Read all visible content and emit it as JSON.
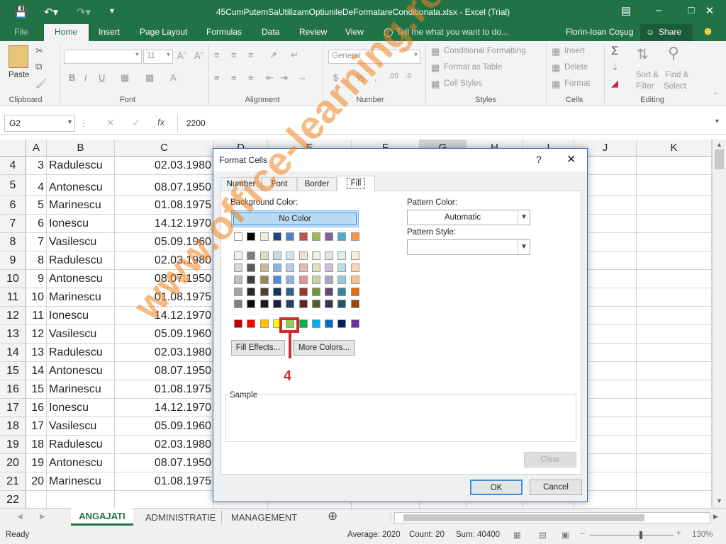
{
  "window": {
    "title": "45CumPutemSaUtilizamOptiunileDeFormatareConditionata.xlsx - Excel (Trial)"
  },
  "ribbon_tabs": [
    {
      "label": "File"
    },
    {
      "label": "Home"
    },
    {
      "label": "Insert"
    },
    {
      "label": "Page Layout"
    },
    {
      "label": "Formulas"
    },
    {
      "label": "Data"
    },
    {
      "label": "Review"
    },
    {
      "label": "View"
    }
  ],
  "tell_me": "Tell me what you want to do...",
  "user": "Florin-Ioan Coşug",
  "share": "Share",
  "ribbon": {
    "paste": "Paste",
    "clipboard": "Clipboard",
    "font_group": "Font",
    "font_size": "11",
    "alignment": "Alignment",
    "number_format": "General",
    "number_group": "Number",
    "conditional_formatting": "Conditional Formatting",
    "format_as_table": "Format as Table",
    "cell_styles": "Cell Styles",
    "styles_group": "Styles",
    "insert": "Insert",
    "delete": "Delete",
    "format": "Format",
    "cells_group": "Cells",
    "sort_filter_1": "Sort &",
    "sort_filter_2": "Filter",
    "find_select_1": "Find &",
    "find_select_2": "Select",
    "editing_group": "Editing"
  },
  "formula_bar": {
    "name_box": "G2",
    "fx": "fx",
    "value": "2200"
  },
  "columns": [
    "A",
    "B",
    "C",
    "D",
    "E",
    "F",
    "G",
    "H",
    "I",
    "J",
    "K"
  ],
  "rows": [
    {
      "n": "4",
      "a": "3",
      "b": "Radulescu",
      "c": "02.03.1980"
    },
    {
      "n": "5",
      "a": "4",
      "b": "Antonescu",
      "c": "08.07.1950"
    },
    {
      "n": "6",
      "a": "5",
      "b": "Marinescu",
      "c": "01.08.1975"
    },
    {
      "n": "7",
      "a": "6",
      "b": "Ionescu",
      "c": "14.12.1970"
    },
    {
      "n": "8",
      "a": "7",
      "b": "Vasilescu",
      "c": "05.09.1960"
    },
    {
      "n": "9",
      "a": "8",
      "b": "Radulescu",
      "c": "02.03.1980"
    },
    {
      "n": "10",
      "a": "9",
      "b": "Antonescu",
      "c": "08.07.1950"
    },
    {
      "n": "11",
      "a": "10",
      "b": "Marinescu",
      "c": "01.08.1975"
    },
    {
      "n": "12",
      "a": "11",
      "b": "Ionescu",
      "c": "14.12.1970"
    },
    {
      "n": "13",
      "a": "12",
      "b": "Vasilescu",
      "c": "05.09.1960"
    },
    {
      "n": "14",
      "a": "13",
      "b": "Radulescu",
      "c": "02.03.1980"
    },
    {
      "n": "15",
      "a": "14",
      "b": "Antonescu",
      "c": "08.07.1950"
    },
    {
      "n": "16",
      "a": "15",
      "b": "Marinescu",
      "c": "01.08.1975"
    },
    {
      "n": "17",
      "a": "16",
      "b": "Ionescu",
      "c": "14.12.1970"
    },
    {
      "n": "18",
      "a": "17",
      "b": "Vasilescu",
      "c": "05.09.1960"
    },
    {
      "n": "19",
      "a": "18",
      "b": "Radulescu",
      "c": "02.03.1980"
    },
    {
      "n": "20",
      "a": "19",
      "b": "Antonescu",
      "c": "08.07.1950"
    },
    {
      "n": "21",
      "a": "20",
      "b": "Marinescu",
      "c": "01.08.1975"
    },
    {
      "n": "22",
      "a": "",
      "b": "",
      "c": ""
    }
  ],
  "sheet_tabs": [
    "ANGAJATI",
    "ADMINISTRATIE",
    "MANAGEMENT"
  ],
  "status": {
    "ready": "Ready",
    "average": "Average: 2020",
    "count": "Count: 20",
    "sum": "Sum: 40400",
    "zoom": "130%"
  },
  "dialog": {
    "title": "Format Cells",
    "help": "?",
    "tabs": [
      "Number",
      "Font",
      "Border",
      "Fill"
    ],
    "background_color": "Background Color:",
    "no_color": "No Color",
    "pattern_color": "Pattern Color:",
    "pattern_color_value": "Automatic",
    "pattern_style": "Pattern Style:",
    "fill_effects": "Fill Effects...",
    "more_colors": "More Colors...",
    "sample": "Sample",
    "clear": "Clear",
    "ok": "OK",
    "cancel": "Cancel",
    "annotation": "4",
    "theme_row": [
      "#ffffff",
      "#000000",
      "#e7e6e6",
      "#44546a",
      "#4472c4",
      "#ed7d31",
      "#a5a5a5",
      "#ffc000",
      "#5b9bd5",
      "#70ad47"
    ],
    "theme_row_alt": [
      "#ffffff",
      "#000000",
      "#eeece1",
      "#1f497d",
      "#4f81bd",
      "#c0504d",
      "#9bbb59",
      "#8064a2",
      "#4bacc6",
      "#f79646"
    ],
    "tints": [
      [
        "#f2f2f2",
        "#7f7f7f",
        "#ddd9c3",
        "#c6d9f0",
        "#dbe5f1",
        "#f2dcdb",
        "#ebf1dd",
        "#e5e0ec",
        "#dbeef3",
        "#fdeada"
      ],
      [
        "#d8d8d8",
        "#595959",
        "#c4bd97",
        "#8db3e2",
        "#b8cce4",
        "#e5b9b7",
        "#d7e3bc",
        "#ccc1d9",
        "#b7dde8",
        "#fbd5b5"
      ],
      [
        "#bfbfbf",
        "#3f3f3f",
        "#938953",
        "#548dd4",
        "#95b3d7",
        "#d99694",
        "#c3d69b",
        "#b2a2c7",
        "#92cddc",
        "#fac08f"
      ],
      [
        "#a5a5a5",
        "#262626",
        "#494429",
        "#17365d",
        "#366092",
        "#953734",
        "#76923c",
        "#5f497a",
        "#31859b",
        "#e36c09"
      ],
      [
        "#7f7f7f",
        "#0c0c0c",
        "#1d1b10",
        "#0f243e",
        "#244061",
        "#632423",
        "#4f6128",
        "#3f3151",
        "#205867",
        "#974806"
      ]
    ],
    "standard": [
      "#c00000",
      "#ff0000",
      "#ffc000",
      "#ffff00",
      "#92d050",
      "#00b050",
      "#00b0f0",
      "#0070c0",
      "#002060",
      "#7030a0"
    ]
  },
  "watermark": "www.office-learning.ro"
}
